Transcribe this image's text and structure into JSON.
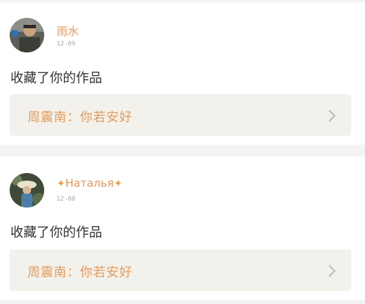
{
  "items": [
    {
      "user": {
        "name": "雨水",
        "prefix": "",
        "suffix": ""
      },
      "date": "12-09",
      "action": "收藏了你的作品",
      "work": {
        "title": "周震南：你若安好"
      }
    },
    {
      "user": {
        "name": "Наталья",
        "prefix": "✦",
        "suffix": "✦"
      },
      "date": "12-08",
      "action": "收藏了你的作品",
      "work": {
        "title": "周震南：你若安好"
      }
    }
  ],
  "colors": {
    "accent": "#e39a5a",
    "background": "#f3f3f3",
    "card": "#ffffff",
    "work_box": "#f2f1eb",
    "date": "#a7a7a7"
  },
  "icons": {
    "avatar": "user-avatar",
    "chevron": "chevron-right-icon"
  }
}
